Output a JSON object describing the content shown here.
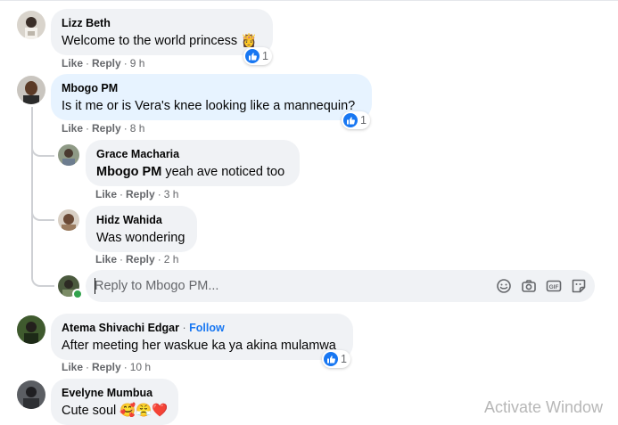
{
  "comments": [
    {
      "author": "Lizz Beth",
      "text": "Welcome to the world princess",
      "emoji": "👸",
      "like": "Like",
      "reply": "Reply",
      "time": "9 h",
      "reactions": "1"
    },
    {
      "author": "Mbogo PM",
      "text": "Is it me or is Vera's knee looking like a mannequin?",
      "like": "Like",
      "reply": "Reply",
      "time": "8 h",
      "reactions": "1",
      "replies": [
        {
          "author": "Grace Macharia",
          "mention": "Mbogo PM",
          "text": " yeah ave noticed too",
          "like": "Like",
          "reply": "Reply",
          "time": "3 h"
        },
        {
          "author": "Hidz Wahida",
          "text": "Was wondering",
          "like": "Like",
          "reply": "Reply",
          "time": "2 h"
        }
      ]
    },
    {
      "author": "Atema Shivachi Edgar",
      "follow": "Follow",
      "text": "After meeting her waskue ka ya akina mulamwa",
      "like": "Like",
      "reply": "Reply",
      "time": "10 h",
      "reactions": "1"
    },
    {
      "author": "Evelyne Mumbua",
      "text": "Cute soul",
      "emoji": "🥰😤❤️"
    }
  ],
  "reply_box": {
    "placeholder": "Reply to Mbogo PM...",
    "icons": [
      "emoji-icon",
      "camera-icon",
      "gif-icon",
      "sticker-icon"
    ]
  },
  "watermark": "Activate Window",
  "colors": {
    "accent": "#1877f2",
    "bubble": "#f0f2f5",
    "bubble_highlight": "#e7f3ff",
    "meta_text": "#65676b",
    "online": "#31a24c"
  }
}
